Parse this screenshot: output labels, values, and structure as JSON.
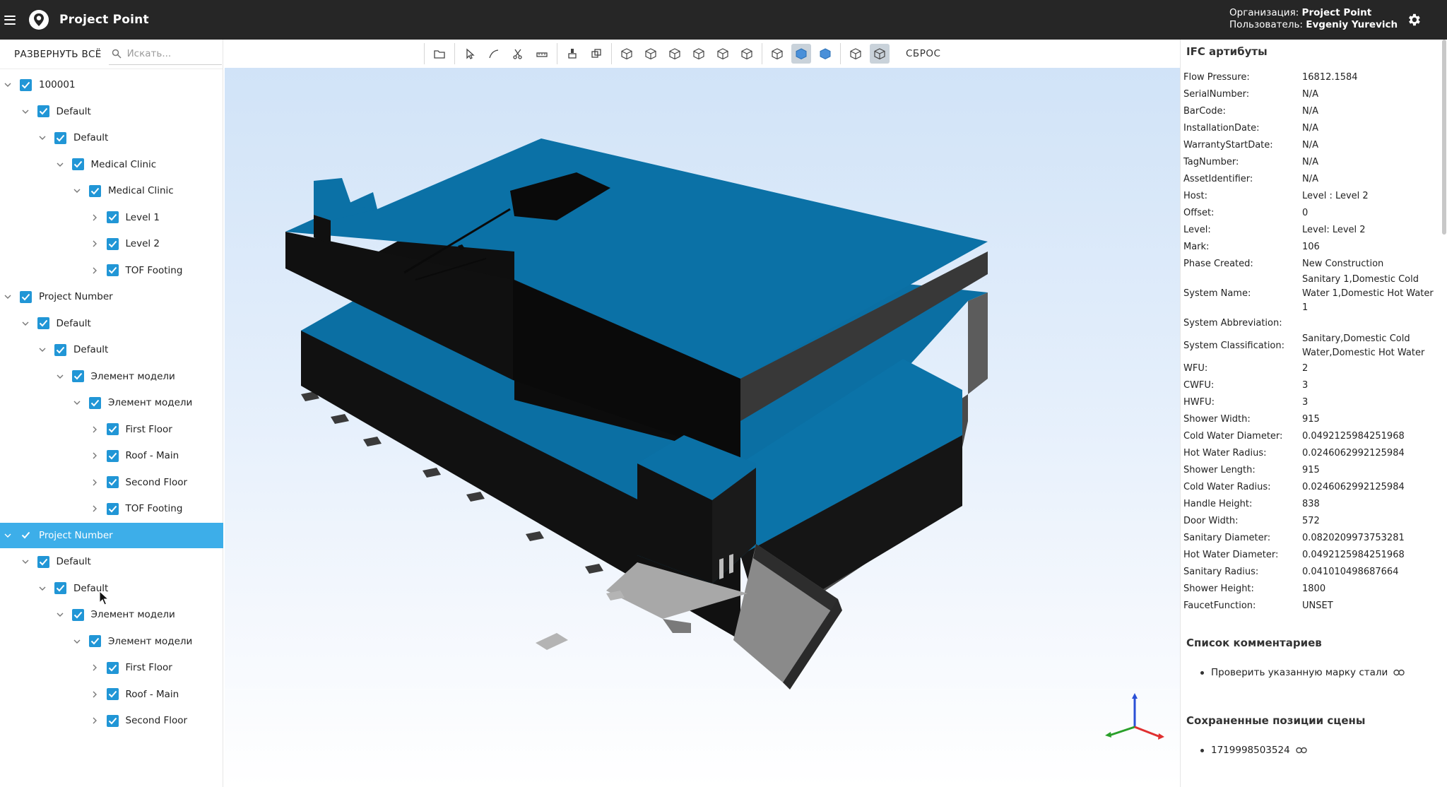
{
  "header": {
    "app_title": "Project Point",
    "org_label": "Организация:",
    "org_value": "Project Point",
    "user_label": "Пользователь:",
    "user_value": "Evgeniy Yurevich"
  },
  "left_panel": {
    "expand_all_label": "РАЗВЕРНУТЬ ВСЁ",
    "search_placeholder": "Искать...",
    "tree": [
      {
        "label": "100001",
        "level": 0,
        "expanded": true,
        "checked": true,
        "selected": false
      },
      {
        "label": "Default",
        "level": 1,
        "expanded": true,
        "checked": true,
        "selected": false
      },
      {
        "label": "Default",
        "level": 2,
        "expanded": true,
        "checked": true,
        "selected": false
      },
      {
        "label": "Medical Clinic",
        "level": 3,
        "expanded": true,
        "checked": true,
        "selected": false
      },
      {
        "label": "Medical Clinic",
        "level": 4,
        "expanded": true,
        "checked": true,
        "selected": false
      },
      {
        "label": "Level 1",
        "level": 5,
        "expanded": false,
        "checked": true,
        "selected": false
      },
      {
        "label": "Level 2",
        "level": 5,
        "expanded": false,
        "checked": true,
        "selected": false
      },
      {
        "label": "TOF Footing",
        "level": 5,
        "expanded": false,
        "checked": true,
        "selected": false
      },
      {
        "label": "Project Number",
        "level": 0,
        "expanded": true,
        "checked": true,
        "selected": false
      },
      {
        "label": "Default",
        "level": 1,
        "expanded": true,
        "checked": true,
        "selected": false
      },
      {
        "label": "Default",
        "level": 2,
        "expanded": true,
        "checked": true,
        "selected": false
      },
      {
        "label": "Элемент модели",
        "level": 3,
        "expanded": true,
        "checked": true,
        "selected": false
      },
      {
        "label": "Элемент модели",
        "level": 4,
        "expanded": true,
        "checked": true,
        "selected": false
      },
      {
        "label": "First Floor",
        "level": 5,
        "expanded": false,
        "checked": true,
        "selected": false
      },
      {
        "label": "Roof - Main",
        "level": 5,
        "expanded": false,
        "checked": true,
        "selected": false
      },
      {
        "label": "Second Floor",
        "level": 5,
        "expanded": false,
        "checked": true,
        "selected": false
      },
      {
        "label": "TOF Footing",
        "level": 5,
        "expanded": false,
        "checked": true,
        "selected": false
      },
      {
        "label": "Project Number",
        "level": 0,
        "expanded": true,
        "checked": true,
        "selected": true
      },
      {
        "label": "Default",
        "level": 1,
        "expanded": true,
        "checked": true,
        "selected": false
      },
      {
        "label": "Default",
        "level": 2,
        "expanded": true,
        "checked": true,
        "selected": false
      },
      {
        "label": "Элемент модели",
        "level": 3,
        "expanded": true,
        "checked": true,
        "selected": false
      },
      {
        "label": "Элемент модели",
        "level": 4,
        "expanded": true,
        "checked": true,
        "selected": false
      },
      {
        "label": "First Floor",
        "level": 5,
        "expanded": false,
        "checked": true,
        "selected": false
      },
      {
        "label": "Roof - Main",
        "level": 5,
        "expanded": false,
        "checked": true,
        "selected": false
      },
      {
        "label": "Second Floor",
        "level": 5,
        "expanded": false,
        "checked": true,
        "selected": false
      }
    ]
  },
  "viewer": {
    "toolbar_groups": [
      [
        {
          "name": "folder-icon",
          "active": false
        }
      ],
      [
        {
          "name": "select-cursor-icon",
          "active": false
        },
        {
          "name": "measure-line-icon",
          "active": false
        },
        {
          "name": "scissors-icon",
          "active": false
        },
        {
          "name": "ruler-icon",
          "active": false
        }
      ],
      [
        {
          "name": "pin-icon",
          "active": false
        },
        {
          "name": "layers-icon",
          "active": false
        }
      ],
      [
        {
          "name": "cube-view-1-icon",
          "active": false
        },
        {
          "name": "cube-view-2-icon",
          "active": false
        },
        {
          "name": "cube-view-3-icon",
          "active": false
        },
        {
          "name": "cube-view-4-icon",
          "active": false
        },
        {
          "name": "cube-view-5-icon",
          "active": false
        },
        {
          "name": "cube-view-6-icon",
          "active": false
        }
      ],
      [
        {
          "name": "wireframe-icon",
          "active": false
        },
        {
          "name": "shaded-icon",
          "active": true
        },
        {
          "name": "solid-icon",
          "active": false
        }
      ],
      [
        {
          "name": "cube-outline-icon",
          "active": false
        },
        {
          "name": "cube-xray-icon",
          "active": true
        }
      ]
    ],
    "reset_label": "СБРОС",
    "colors": {
      "roof": "#0b71a6",
      "wall": "#0e0e0e",
      "accent": "#2196d6",
      "selected_row": "#3daee9"
    }
  },
  "right_panel": {
    "ifc_title": "IFC артибуты",
    "attributes": [
      {
        "key": "Flow Pressure:",
        "value": "16812.1584"
      },
      {
        "key": "SerialNumber:",
        "value": "N/A"
      },
      {
        "key": "BarCode:",
        "value": "N/A"
      },
      {
        "key": "InstallationDate:",
        "value": "N/A"
      },
      {
        "key": "WarrantyStartDate:",
        "value": "N/A"
      },
      {
        "key": "TagNumber:",
        "value": "N/A"
      },
      {
        "key": "AssetIdentifier:",
        "value": "N/A"
      },
      {
        "key": "Host:",
        "value": "Level : Level 2"
      },
      {
        "key": "Offset:",
        "value": "0"
      },
      {
        "key": "Level:",
        "value": "Level: Level 2"
      },
      {
        "key": "Mark:",
        "value": "106"
      },
      {
        "key": "Phase Created:",
        "value": "New Construction"
      },
      {
        "key": "System Name:",
        "value": "Sanitary 1,Domestic Cold Water 1,Domestic Hot Water 1"
      },
      {
        "key": "System Abbreviation:",
        "value": ""
      },
      {
        "key": "System Classification:",
        "value": "Sanitary,Domestic Cold Water,Domestic Hot Water"
      },
      {
        "key": "WFU:",
        "value": "2"
      },
      {
        "key": "CWFU:",
        "value": "3"
      },
      {
        "key": "HWFU:",
        "value": "3"
      },
      {
        "key": "Shower Width:",
        "value": "915"
      },
      {
        "key": "Cold Water Diameter:",
        "value": "0.0492125984251968"
      },
      {
        "key": "Hot Water Radius:",
        "value": "0.0246062992125984"
      },
      {
        "key": "Shower Length:",
        "value": "915"
      },
      {
        "key": "Cold Water Radius:",
        "value": "0.0246062992125984"
      },
      {
        "key": "Handle Height:",
        "value": "838"
      },
      {
        "key": "Door Width:",
        "value": "572"
      },
      {
        "key": "Sanitary Diameter:",
        "value": "0.0820209973753281"
      },
      {
        "key": "Hot Water Diameter:",
        "value": "0.0492125984251968"
      },
      {
        "key": "Sanitary Radius:",
        "value": "0.041010498687664"
      },
      {
        "key": "Shower Height:",
        "value": "1800"
      },
      {
        "key": "FaucetFunction:",
        "value": "UNSET"
      }
    ],
    "comments_title": "Список комментариев",
    "comments": [
      "Проверить указанную марку стали"
    ],
    "positions_title": "Сохраненные позиции сцены",
    "positions": [
      "1719998503524"
    ]
  }
}
